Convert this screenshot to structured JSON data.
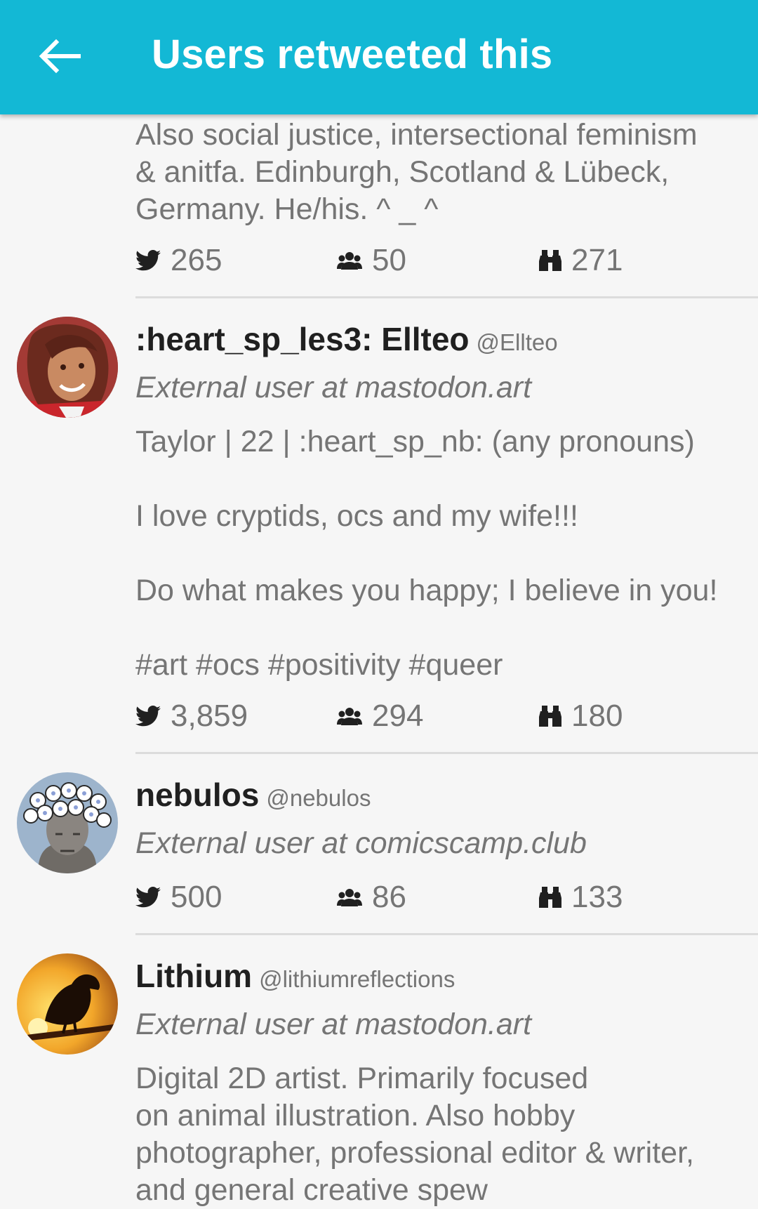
{
  "appbar": {
    "title": "Users retweeted this",
    "back_icon": "arrow-left-icon"
  },
  "colors": {
    "appbar": "#13b8d5",
    "name": "#202020",
    "secondary": "#757575",
    "divider": "#dcdcdc"
  },
  "users": [
    {
      "bio": "Also social justice, intersectional feminism\n& anitfa. Edinburgh, Scotland & Lübeck,\nGermany. He/his.  ^ _ ^",
      "stats": {
        "statuses": "265",
        "following": "50",
        "followers": "271"
      }
    },
    {
      "display_name": ":heart_sp_les3:  Ellteo",
      "handle": "@Ellteo",
      "instance_line": "External user at mastodon.art",
      "bio": "Taylor | 22 | :heart_sp_nb: (any pronouns)\n\nI love cryptids, ocs and my wife!!!\n\nDo what makes you happy; I believe in you!\n\n#art #ocs #positivity #queer",
      "stats": {
        "statuses": "3,859",
        "following": "294",
        "followers": "180"
      }
    },
    {
      "display_name": "nebulos",
      "handle": "@nebulos",
      "instance_line": "External user at comicscamp.club",
      "stats": {
        "statuses": "500",
        "following": "86",
        "followers": "133"
      }
    },
    {
      "display_name": "Lithium",
      "handle": "@lithiumreflections",
      "instance_line": "External user at mastodon.art",
      "bio": "Digital 2D artist. Primarily focused\non animal illustration. Also hobby\nphotographer, professional editor & writer,\nand general creative spew"
    }
  ],
  "stat_icons": {
    "statuses": "bird-icon",
    "following": "people-icon",
    "followers": "binoculars-icon"
  }
}
